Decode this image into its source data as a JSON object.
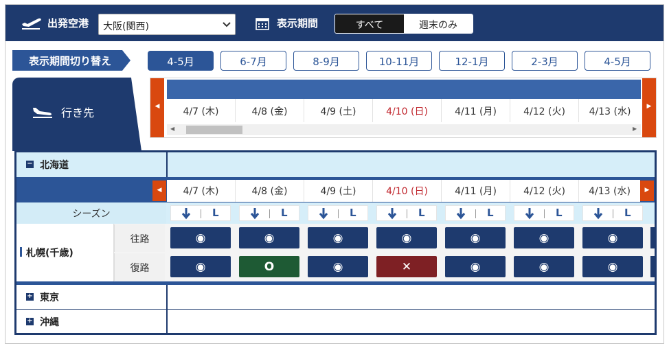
{
  "header": {
    "departure_label": "出発空港",
    "departure_value": "大阪(関西)",
    "period_label": "表示期間",
    "toggle_all": "すべて",
    "toggle_weekend": "週末のみ"
  },
  "period_switch": {
    "label": "表示期間切り替え",
    "options": [
      "4-5月",
      "6-7月",
      "8-9月",
      "10-11月",
      "12-1月",
      "2-3月",
      "4-5月"
    ],
    "selected_index": 0
  },
  "destination_tab": {
    "label": "行き先"
  },
  "dates": [
    {
      "label": "4/7 (木)",
      "sunday": false
    },
    {
      "label": "4/8 (金)",
      "sunday": false
    },
    {
      "label": "4/9 (土)",
      "sunday": false
    },
    {
      "label": "4/10 (日)",
      "sunday": true
    },
    {
      "label": "4/11 (月)",
      "sunday": false
    },
    {
      "label": "4/12 (火)",
      "sunday": false
    },
    {
      "label": "4/13 (水)",
      "sunday": false
    }
  ],
  "regions": [
    {
      "name": "北海道",
      "expanded": true
    },
    {
      "name": "東京",
      "expanded": false
    },
    {
      "name": "沖縄",
      "expanded": false
    }
  ],
  "season_label": "シーズン",
  "season_chip_letter": "L",
  "city": {
    "name": "札幌(千歳)",
    "outbound_label": "往路",
    "return_label": "復路",
    "outbound": [
      "◉",
      "◉",
      "◉",
      "◉",
      "◉",
      "◉",
      "◉"
    ],
    "return": [
      "◉",
      "O",
      "◉",
      "✕",
      "◉",
      "◉",
      "◉"
    ],
    "return_status": [
      "available",
      "good",
      "available",
      "soldout",
      "available",
      "available",
      "available"
    ]
  },
  "colors": {
    "header_navy": "#1e3a6e",
    "accent_blue": "#2c5597",
    "sunday_red": "#c0262d",
    "arrow_orange": "#d9480f",
    "good_green": "#1e5a34",
    "soldout_red": "#7e2024"
  }
}
